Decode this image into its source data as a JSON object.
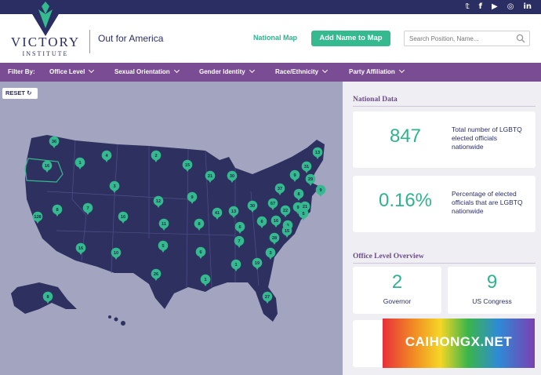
{
  "social": {
    "icons": [
      "twitter-icon",
      "facebook-icon",
      "youtube-icon",
      "instagram-icon",
      "linkedin-icon"
    ],
    "glyphs": [
      "𝕥",
      "f",
      "▶",
      "◎",
      "in"
    ]
  },
  "brand": {
    "name": "VICTORY",
    "sub": "INSTITUTE",
    "site_title": "Out for America"
  },
  "nav": {
    "national_map": "National Map",
    "add_button": "Add Name to Map"
  },
  "search": {
    "placeholder": "Search Position, Name..."
  },
  "filters": {
    "label": "Filter By:",
    "items": [
      "Office Level",
      "Sexual Orientation",
      "Gender Identity",
      "Race/Ethnicity",
      "Party Affiliation"
    ]
  },
  "map": {
    "reset_label": "RESET",
    "markers": [
      "36",
      "16",
      "1",
      "4",
      "2",
      "15",
      "13",
      "21",
      "30",
      "31",
      "9",
      "29",
      "3",
      "9",
      "37",
      "8",
      "9",
      "12",
      "9",
      "41",
      "13",
      "30",
      "67",
      "22",
      "21",
      "5",
      "128",
      "8",
      "7",
      "16",
      "8",
      "11",
      "6",
      "6",
      "3",
      "16",
      "15",
      "7",
      "28",
      "3",
      "16",
      "10",
      "5",
      "6",
      "1",
      "19",
      "26",
      "1",
      "8",
      "27"
    ]
  },
  "colors": {
    "navy": "#2b2e63",
    "green": "#35b98e",
    "purple": "#7a4c94",
    "map_bg": "#a3a5c0"
  },
  "national": {
    "heading": "National Data",
    "total": {
      "value": "847",
      "desc": "Total number of LGBTQ elected officials nationwide"
    },
    "percent": {
      "value": "0.16%",
      "desc": "Percentage of elected officials that are LGBTQ nationwide"
    }
  },
  "office": {
    "heading": "Office Level Overview",
    "cards": [
      {
        "value": "2",
        "label": "Governor"
      },
      {
        "value": "9",
        "label": "US Congress"
      }
    ]
  },
  "watermark": {
    "text": "CAIHONGX.NET"
  }
}
